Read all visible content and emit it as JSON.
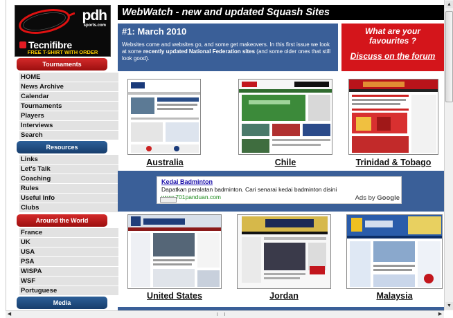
{
  "logo": {
    "pdh": "pdh",
    "pdh_sub": "sports.com",
    "brand": "Tecnifibre",
    "tagline": "FREE T-SHIRT WITH ORDER"
  },
  "sidebar": {
    "tournaments": {
      "heading": "Tournaments",
      "items": [
        "HOME",
        "News Archive",
        "Calendar",
        "Tournaments",
        "Players",
        "Interviews",
        "Search"
      ]
    },
    "resources": {
      "heading": "Resources",
      "items": [
        "Links",
        "Let's Talk",
        "Coaching",
        "Rules",
        "Useful Info",
        "Clubs"
      ]
    },
    "world": {
      "heading": "Around the World",
      "items": [
        "France",
        "UK",
        "USA",
        "PSA",
        "WISPA",
        "WSF",
        "Portuguese"
      ]
    },
    "media": {
      "heading": "Media"
    }
  },
  "main": {
    "heading": "WebWatch - new and updated Squash Sites",
    "intro": {
      "title": "#1: March 2010",
      "body_1": "Websites come and websites go, and some get makeovers. In this first issue we look at some ",
      "body_bold": "recently updated National Federation sites",
      "body_2": " (and some older ones that still look good)."
    },
    "promo": {
      "question_1": "What are your",
      "question_2": "favourites ?",
      "link": "Discuss on the forum"
    },
    "sites_row1": [
      "Australia",
      "Chile",
      "Trinidad & Tobago"
    ],
    "sites_row2": [
      "United States",
      "Jordan",
      "Malaysia"
    ],
    "ad": {
      "title": "Kedai Badminton",
      "desc": "Dapatkan peralatan badminton. Cari senarai kedai badminton disini",
      "url": "www.701panduan.com",
      "by": "Ads by",
      "google": "Google"
    }
  },
  "colors": {
    "header_black": "#000000",
    "section_blue": "#3a5f98",
    "promo_red": "#d4151b",
    "nav_gray": "#e2e2e2"
  }
}
